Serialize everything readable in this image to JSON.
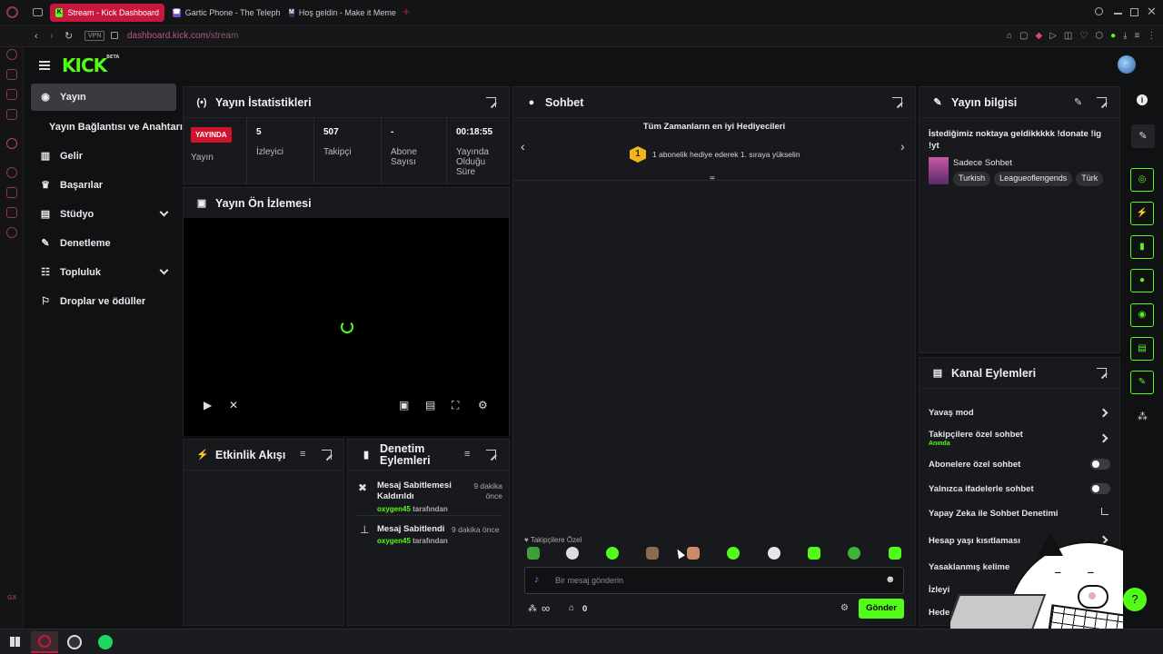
{
  "browser": {
    "tabs": [
      {
        "label": "Stream - Kick Dashboard",
        "icon": "kick-favicon",
        "active": true
      },
      {
        "label": "Gartic Phone - The Teleph",
        "icon": "gartic-favicon",
        "active": false
      },
      {
        "label": "Hoş geldin - Make it Meme",
        "icon": "mim-favicon",
        "active": false
      }
    ],
    "vpn_label": "VPN",
    "url_host": "dashboard.kick.com",
    "url_path": "/stream"
  },
  "logo": {
    "text": "KICK",
    "badge": "BETA"
  },
  "sidebar": {
    "items": [
      {
        "label": "Yayın",
        "icon": "broadcast-icon"
      },
      {
        "label": "Yayın Bağlantısı ve Anahtarı",
        "icon": ""
      },
      {
        "label": "Gelir",
        "icon": "chart-icon"
      },
      {
        "label": "Başarılar",
        "icon": "trophy-icon"
      },
      {
        "label": "Stüdyo",
        "icon": "studio-icon"
      },
      {
        "label": "Denetleme",
        "icon": "wrench-icon"
      },
      {
        "label": "Topluluk",
        "icon": "community-icon"
      },
      {
        "label": "Droplar ve ödüller",
        "icon": "drops-icon"
      }
    ]
  },
  "stats": {
    "title": "Yayın İstatistikleri",
    "live_badge": "YAYINDA",
    "cells": [
      {
        "value": "",
        "label": "Yayın"
      },
      {
        "value": "5",
        "label": "İzleyici"
      },
      {
        "value": "507",
        "label": "Takipçi"
      },
      {
        "value": "-",
        "label": "Abone Sayısı"
      },
      {
        "value": "00:18:55",
        "label": "Yayında Olduğu Süre"
      }
    ]
  },
  "preview": {
    "title": "Yayın Ön İzlemesi"
  },
  "activity": {
    "title": "Etkinlik Akışı"
  },
  "mod_actions": {
    "title": "Denetim Eylemleri",
    "items": [
      {
        "title": "Mesaj Sabitlemesi Kaldırıldı",
        "user": "oxygen45",
        "suffix": "tarafından",
        "time": "9 dakika önce",
        "icon": "unpin-icon"
      },
      {
        "title": "Mesaj Sabitlendi",
        "user": "oxygen45",
        "suffix": "tarafından",
        "time": "9 dakika önce",
        "icon": "pin-icon"
      }
    ]
  },
  "chat": {
    "title": "Sohbet",
    "gifters_title": "Tüm Zamanların en iyi Hediyecileri",
    "gifters_rank": "1",
    "gifters_text": "1 abonelik hediye ederek 1. sıraya yükselin",
    "follower_only_label": "Takipçilere Özel",
    "input_placeholder": "Bir mesaj gönderin",
    "points": "∞",
    "store_count": "0",
    "send_label": "Gönder"
  },
  "stream_info": {
    "title": "Yayın bilgisi",
    "stream_title": "İstediğimiz noktaya geldikkkkk !donate !ig !yt",
    "category": "Sadece Sohbet",
    "tags": [
      "Turkish",
      "Leagueoflengends",
      "Türk"
    ]
  },
  "channel_actions": {
    "title": "Kanal Eylemleri",
    "items": [
      {
        "label": "Yavaş mod",
        "control": "chevron"
      },
      {
        "label": "Takipçilere özel sohbet",
        "sub": "Anında",
        "control": "chevron"
      },
      {
        "label": "Abonelere özel sohbet",
        "control": "toggle"
      },
      {
        "label": "Yalnızca ifadelerle sohbet",
        "control": "toggle"
      },
      {
        "label": "Yapay Zeka ile Sohbet Denetimi",
        "control": "external"
      },
      {
        "label": "Hesap yaşı kısıtlaması",
        "control": "chevron"
      },
      {
        "label": "Yasaklanmış kelime",
        "control": "none"
      },
      {
        "label": "İzleyi",
        "control": "none"
      },
      {
        "label": "Hede",
        "control": "none"
      }
    ]
  },
  "colors": {
    "accent": "#53fc18",
    "live": "#d0132b",
    "tab_active": "#c8173f"
  }
}
